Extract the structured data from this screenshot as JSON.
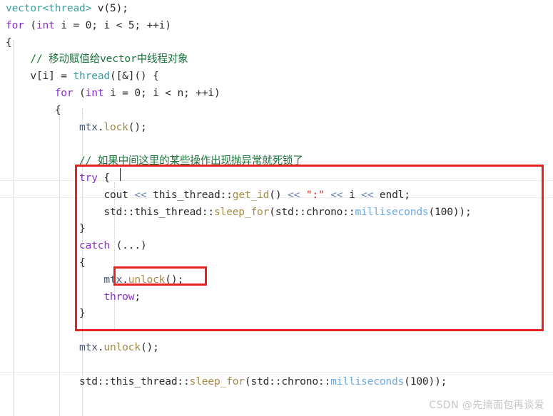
{
  "window": {
    "kind": "code-editor-screenshot",
    "language": "C++"
  },
  "colors": {
    "keyword": "#8b2fc9",
    "type": "#3a9e9e",
    "comment": "#19733a",
    "string": "#d42a2a",
    "operator": "#6b86b5",
    "function": "#a58b4a",
    "class": "#6fa8dc",
    "annotation_red": "#e8231f",
    "background": "#ffffff",
    "watermark": "#c6c6c6"
  },
  "code": {
    "lines": [
      {
        "indent": 0,
        "tokens": [
          {
            "t": "vector<thread>",
            "c": "type"
          },
          {
            "t": " v(5);",
            "c": "plain"
          }
        ]
      },
      {
        "indent": 0,
        "tokens": [
          {
            "t": "for",
            "c": "kw"
          },
          {
            "t": " (",
            "c": "plain"
          },
          {
            "t": "int",
            "c": "kw"
          },
          {
            "t": " i = 0; i < 5; ++i)",
            "c": "plain"
          }
        ]
      },
      {
        "indent": 0,
        "tokens": [
          {
            "t": "{",
            "c": "plain"
          }
        ]
      },
      {
        "indent": 1,
        "tokens": [
          {
            "t": "// 移动赋值给vector中线程对象",
            "c": "cmt"
          }
        ]
      },
      {
        "indent": 1,
        "tokens": [
          {
            "t": "v[i] = ",
            "c": "plain"
          },
          {
            "t": "thread",
            "c": "type"
          },
          {
            "t": "([&]() {",
            "c": "plain"
          }
        ]
      },
      {
        "indent": 2,
        "tokens": [
          {
            "t": "for",
            "c": "kw"
          },
          {
            "t": " (",
            "c": "plain"
          },
          {
            "t": "int",
            "c": "kw"
          },
          {
            "t": " i = 0; i < n; ++i)",
            "c": "plain"
          }
        ]
      },
      {
        "indent": 2,
        "tokens": [
          {
            "t": "{",
            "c": "plain"
          }
        ]
      },
      {
        "indent": 3,
        "tokens": [
          {
            "t": "mtx",
            "c": "mtx"
          },
          {
            "t": ".",
            "c": "plain"
          },
          {
            "t": "lock",
            "c": "fn"
          },
          {
            "t": "();",
            "c": "plain"
          }
        ]
      },
      {
        "indent": 3,
        "tokens": [
          {
            "t": "",
            "c": "plain"
          }
        ]
      },
      {
        "indent": 3,
        "tokens": [
          {
            "t": "// 如果中间这里的某些操作出现抛异常就死锁了",
            "c": "cmt"
          }
        ]
      },
      {
        "indent": 3,
        "tokens": [
          {
            "t": "try",
            "c": "kw"
          },
          {
            "t": " {",
            "c": "plain"
          }
        ]
      },
      {
        "indent": 4,
        "tokens": [
          {
            "t": "cout ",
            "c": "plain"
          },
          {
            "t": "<<",
            "c": "op"
          },
          {
            "t": " this_thread::",
            "c": "plain"
          },
          {
            "t": "get_id",
            "c": "fn"
          },
          {
            "t": "() ",
            "c": "plain"
          },
          {
            "t": "<<",
            "c": "op"
          },
          {
            "t": " ",
            "c": "plain"
          },
          {
            "t": "\":\"",
            "c": "str"
          },
          {
            "t": " ",
            "c": "plain"
          },
          {
            "t": "<<",
            "c": "op"
          },
          {
            "t": " i ",
            "c": "plain"
          },
          {
            "t": "<<",
            "c": "op"
          },
          {
            "t": " endl;",
            "c": "plain"
          }
        ]
      },
      {
        "indent": 4,
        "tokens": [
          {
            "t": "std::this_thread::",
            "c": "plain"
          },
          {
            "t": "sleep_for",
            "c": "fn"
          },
          {
            "t": "(std::chrono::",
            "c": "plain"
          },
          {
            "t": "milliseconds",
            "c": "cls"
          },
          {
            "t": "(100));",
            "c": "plain"
          }
        ]
      },
      {
        "indent": 3,
        "tokens": [
          {
            "t": "}",
            "c": "plain"
          }
        ]
      },
      {
        "indent": 3,
        "tokens": [
          {
            "t": "catch",
            "c": "kw"
          },
          {
            "t": " (...)",
            "c": "plain"
          }
        ]
      },
      {
        "indent": 3,
        "tokens": [
          {
            "t": "{",
            "c": "plain"
          }
        ]
      },
      {
        "indent": 4,
        "tokens": [
          {
            "t": "mtx",
            "c": "mtx"
          },
          {
            "t": ".",
            "c": "plain"
          },
          {
            "t": "unlock",
            "c": "fn"
          },
          {
            "t": "();",
            "c": "plain"
          }
        ]
      },
      {
        "indent": 4,
        "tokens": [
          {
            "t": "throw",
            "c": "kw"
          },
          {
            "t": ";",
            "c": "plain"
          }
        ]
      },
      {
        "indent": 3,
        "tokens": [
          {
            "t": "}",
            "c": "plain"
          }
        ]
      },
      {
        "indent": 3,
        "tokens": [
          {
            "t": "",
            "c": "plain"
          }
        ]
      },
      {
        "indent": 3,
        "tokens": [
          {
            "t": "mtx",
            "c": "mtx"
          },
          {
            "t": ".",
            "c": "plain"
          },
          {
            "t": "unlock",
            "c": "fn"
          },
          {
            "t": "();",
            "c": "plain"
          }
        ]
      },
      {
        "indent": 3,
        "tokens": [
          {
            "t": "",
            "c": "plain"
          }
        ]
      },
      {
        "indent": 3,
        "tokens": [
          {
            "t": "std::this_thread::",
            "c": "plain"
          },
          {
            "t": "sleep_for",
            "c": "fn"
          },
          {
            "t": "(std::chrono::",
            "c": "plain"
          },
          {
            "t": "milliseconds",
            "c": "cls"
          },
          {
            "t": "(100));",
            "c": "plain"
          }
        ]
      }
    ]
  },
  "annotations": [
    {
      "id": "outer-box",
      "shape": "rectangle",
      "color": "#e8231f",
      "encloses": "try-catch block from 'try {' through closing '}' of catch"
    },
    {
      "id": "inner-box",
      "shape": "rectangle",
      "color": "#e8231f",
      "encloses": "mtx.unlock(); inside catch block"
    }
  ],
  "watermark": {
    "text": "CSDN @先搞面包再谈爱"
  }
}
